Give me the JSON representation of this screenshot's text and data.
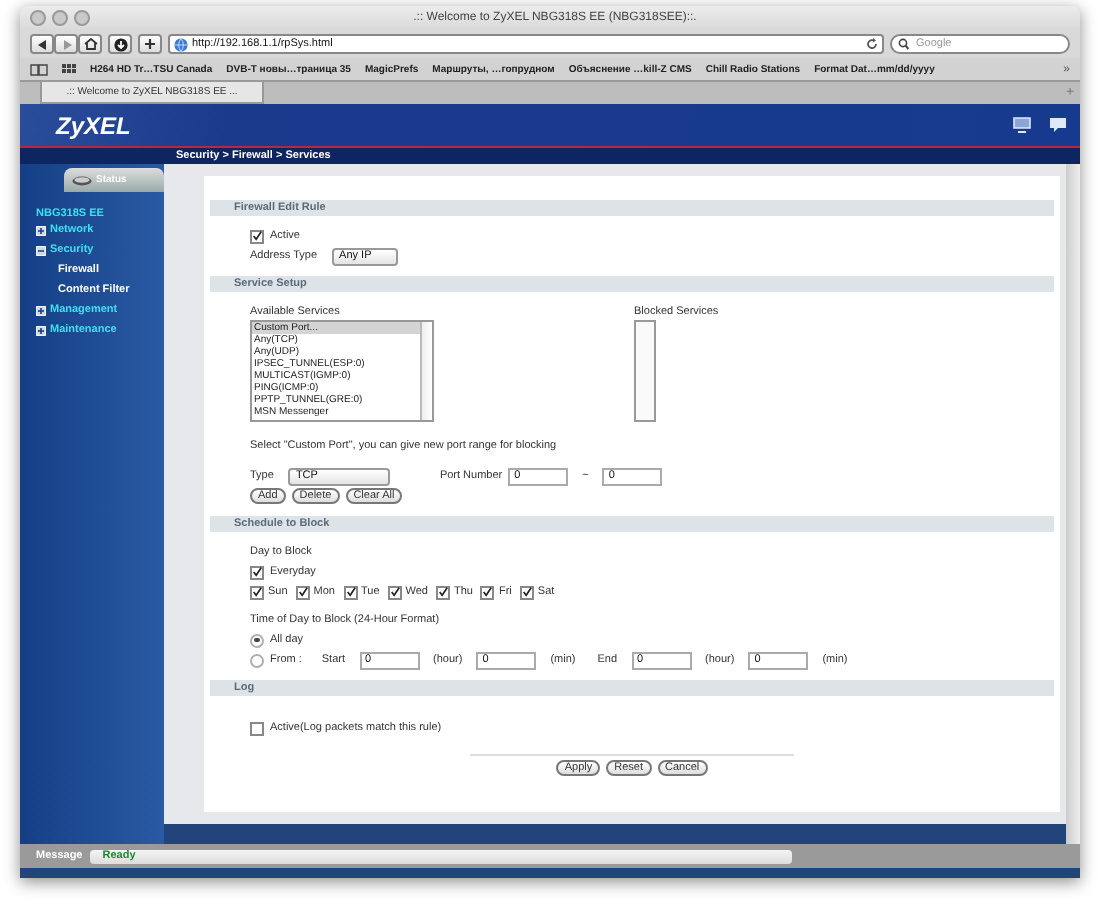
{
  "browser": {
    "title": ".:: Welcome to ZyXEL NBG318S EE (NBG318SEE)::.",
    "url": "http://192.168.1.1/rpSys.html",
    "search": {
      "placeholder": "Google"
    },
    "bookmarks": [
      "H264 HD Tr…TSU Canada",
      "DVB-T новы…траница 35",
      "MagicPrefs",
      "Маршруты, …гопрудном",
      "Объяснение …kill-Z CMS",
      "Chill Radio Stations",
      "Format Dat…mm/dd/yyyy"
    ],
    "bookmarks_more": "»",
    "tabs": [
      {
        "label": ".:: Welcome to ZyXEL NBG318S EE ...",
        "selected": true
      }
    ],
    "new_tab": "+"
  },
  "header": {
    "logo": "ZyXEL",
    "breadcrumb": "Security > Firewall > Services"
  },
  "sidebar": {
    "status_tab": "Status",
    "device": "NBG318S EE",
    "items": [
      {
        "label": "Network",
        "expanded": false
      },
      {
        "label": "Security",
        "expanded": true,
        "children": [
          {
            "label": "Firewall"
          },
          {
            "label": "Content Filter"
          }
        ]
      },
      {
        "label": "Management",
        "expanded": false
      },
      {
        "label": "Maintenance",
        "expanded": false
      }
    ]
  },
  "firewall_edit_rule": {
    "title": "Firewall Edit Rule",
    "active": {
      "label": "Active",
      "checked": true
    },
    "address_type": {
      "label": "Address Type",
      "value": "Any IP"
    }
  },
  "service_setup": {
    "title": "Service Setup",
    "available_label": "Available Services",
    "available_services": [
      {
        "label": "Custom Port...",
        "selected": true
      },
      {
        "label": "Any(TCP)",
        "selected": false
      },
      {
        "label": "Any(UDP)",
        "selected": false
      },
      {
        "label": "IPSEC_TUNNEL(ESP:0)",
        "selected": false
      },
      {
        "label": "MULTICAST(IGMP:0)",
        "selected": false
      },
      {
        "label": "PING(ICMP:0)",
        "selected": false
      },
      {
        "label": "PPTP_TUNNEL(GRE:0)",
        "selected": false
      },
      {
        "label": "MSN Messenger",
        "selected": false
      }
    ],
    "blocked_label": "Blocked Services",
    "hint": "Select \"Custom Port\", you can give new port range for blocking",
    "type_label": "Type",
    "type_value": "TCP",
    "port_label": "Port Number",
    "port_from": "0",
    "port_sep": "~",
    "port_to": "0",
    "buttons": [
      "Add",
      "Delete",
      "Clear All"
    ]
  },
  "schedule": {
    "title": "Schedule to Block",
    "day_label": "Day to Block",
    "everyday": {
      "label": "Everyday",
      "checked": true
    },
    "days": [
      {
        "label": "Sun",
        "checked": true
      },
      {
        "label": "Mon",
        "checked": true
      },
      {
        "label": "Tue",
        "checked": true
      },
      {
        "label": "Wed",
        "checked": true
      },
      {
        "label": "Thu",
        "checked": true
      },
      {
        "label": "Fri",
        "checked": true
      },
      {
        "label": "Sat",
        "checked": true
      }
    ],
    "time_label": "Time of Day to Block (24-Hour Format)",
    "all_day": {
      "label": "All day",
      "selected": true
    },
    "from": {
      "label": "From :",
      "selected": false,
      "parts": [
        {
          "kind": "label",
          "text": "Start"
        },
        {
          "kind": "field",
          "value": "0"
        },
        {
          "kind": "label",
          "text": "(hour)"
        },
        {
          "kind": "field",
          "value": "0"
        },
        {
          "kind": "label",
          "text": "(min)"
        },
        {
          "kind": "label",
          "text": "End"
        },
        {
          "kind": "field",
          "value": "0"
        },
        {
          "kind": "label",
          "text": "(hour)"
        },
        {
          "kind": "field",
          "value": "0"
        },
        {
          "kind": "label",
          "text": "(min)"
        }
      ]
    }
  },
  "log": {
    "title": "Log",
    "active": {
      "label": "Active(Log packets match this rule)",
      "checked": false
    }
  },
  "actions": [
    "Apply",
    "Reset",
    "Cancel"
  ],
  "status_bar": {
    "label": "Message",
    "text": "Ready"
  }
}
